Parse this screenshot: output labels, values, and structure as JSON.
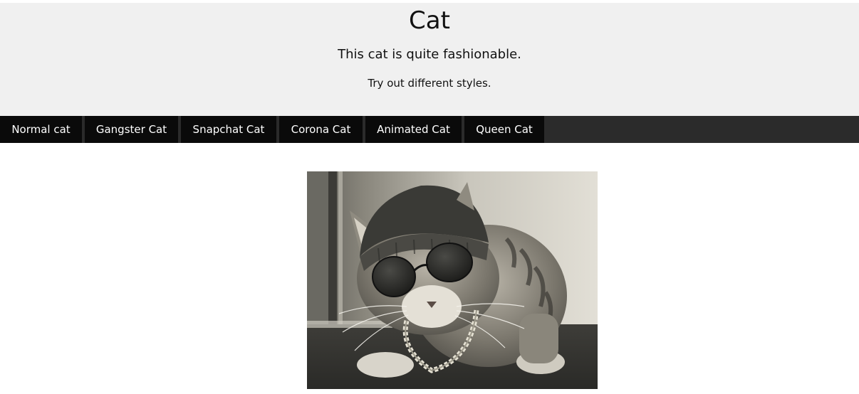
{
  "header": {
    "title": "Cat",
    "subtitle": "This cat is quite fashionable.",
    "hint": "Try out different styles."
  },
  "nav": {
    "items": [
      {
        "label": "Normal cat"
      },
      {
        "label": "Gangster Cat"
      },
      {
        "label": "Snapchat Cat"
      },
      {
        "label": "Corona Cat"
      },
      {
        "label": "Animated Cat"
      },
      {
        "label": "Queen Cat"
      }
    ]
  },
  "photo": {
    "subject": "cat wearing beanie, sunglasses and chain"
  },
  "colors": {
    "header_bg": "#f0f0f0",
    "nav_bg": "#2b2b2b",
    "nav_item_bg": "#0a0a0a",
    "nav_text": "#ffffff"
  }
}
